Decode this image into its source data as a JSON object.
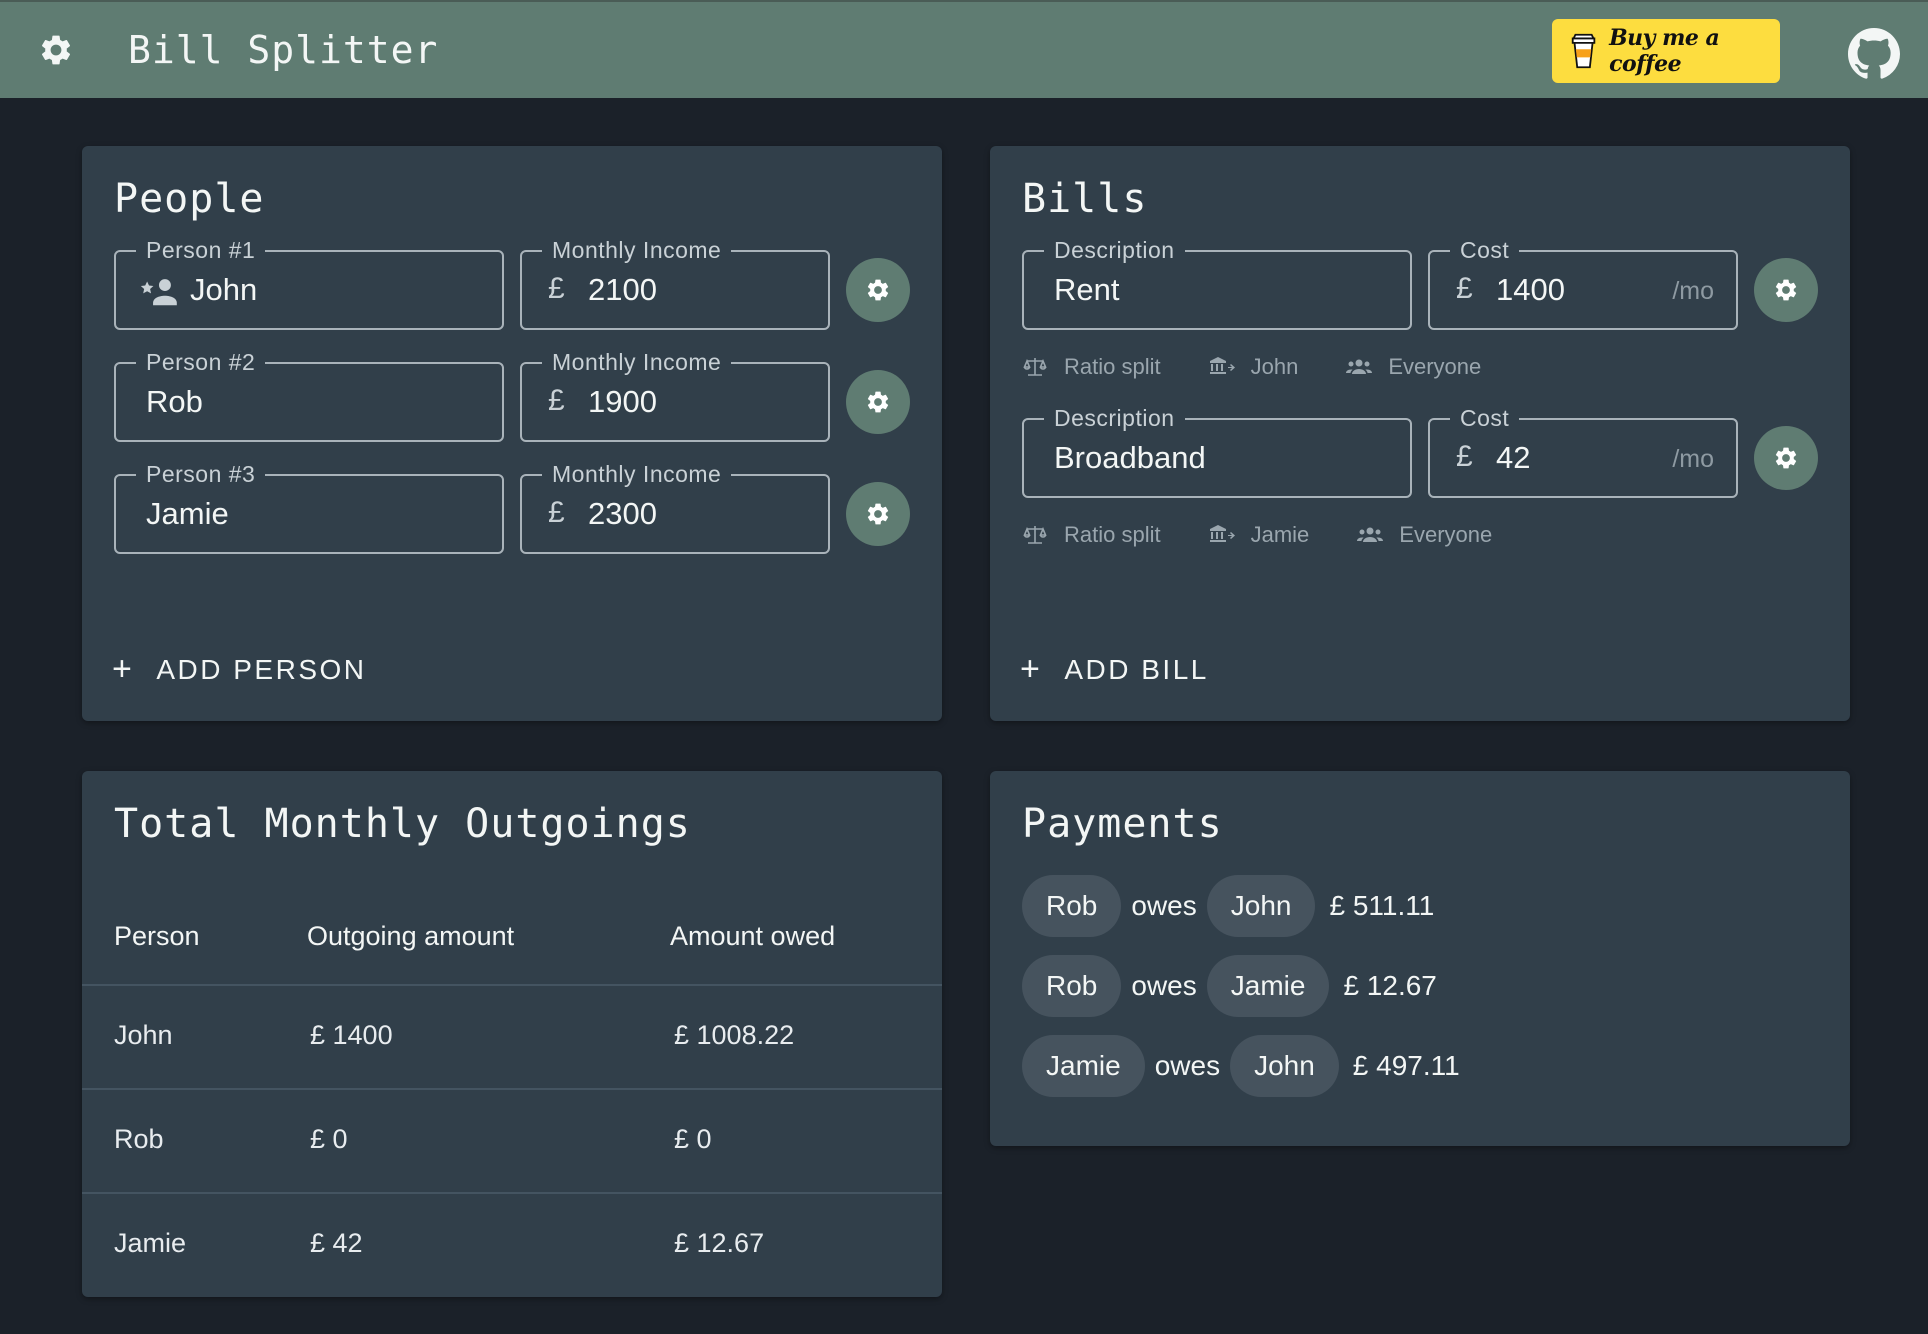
{
  "header": {
    "title": "Bill Splitter",
    "coffee_label": "Buy me a coffee",
    "bar_color": "#5f7c72",
    "coffee_color": "#fddd3f"
  },
  "people": {
    "title": "People",
    "income_label": "Monthly Income",
    "currency": "£",
    "persons": [
      {
        "label": "Person #1",
        "name": "John",
        "income": "2100"
      },
      {
        "label": "Person #2",
        "name": "Rob",
        "income": "1900"
      },
      {
        "label": "Person #3",
        "name": "Jamie",
        "income": "2300"
      }
    ],
    "add_label": "ADD PERSON"
  },
  "bills": {
    "title": "Bills",
    "desc_label": "Description",
    "cost_label": "Cost",
    "currency": "£",
    "period": "/mo",
    "items": [
      {
        "description": "Rent",
        "cost": "1400",
        "split": "Ratio split",
        "payer": "John",
        "shared": "Everyone"
      },
      {
        "description": "Broadband",
        "cost": "42",
        "split": "Ratio split",
        "payer": "Jamie",
        "shared": "Everyone"
      }
    ],
    "add_label": "ADD BILL"
  },
  "outgoings": {
    "title": "Total Monthly Outgoings",
    "columns": [
      "Person",
      "Outgoing amount",
      "Amount owed"
    ],
    "rows": [
      {
        "person": "John",
        "outgoing": "£ 1400",
        "owed": "£ 1008.22"
      },
      {
        "person": "Rob",
        "outgoing": "£ 0",
        "owed": "£ 0"
      },
      {
        "person": "Jamie",
        "outgoing": "£ 42",
        "owed": "£ 12.67"
      }
    ]
  },
  "payments": {
    "title": "Payments",
    "verb": "owes",
    "items": [
      {
        "from": "Rob",
        "to": "John",
        "amount": "£ 511.11"
      },
      {
        "from": "Rob",
        "to": "Jamie",
        "amount": "£ 12.67"
      },
      {
        "from": "Jamie",
        "to": "John",
        "amount": "£ 497.11"
      }
    ]
  }
}
